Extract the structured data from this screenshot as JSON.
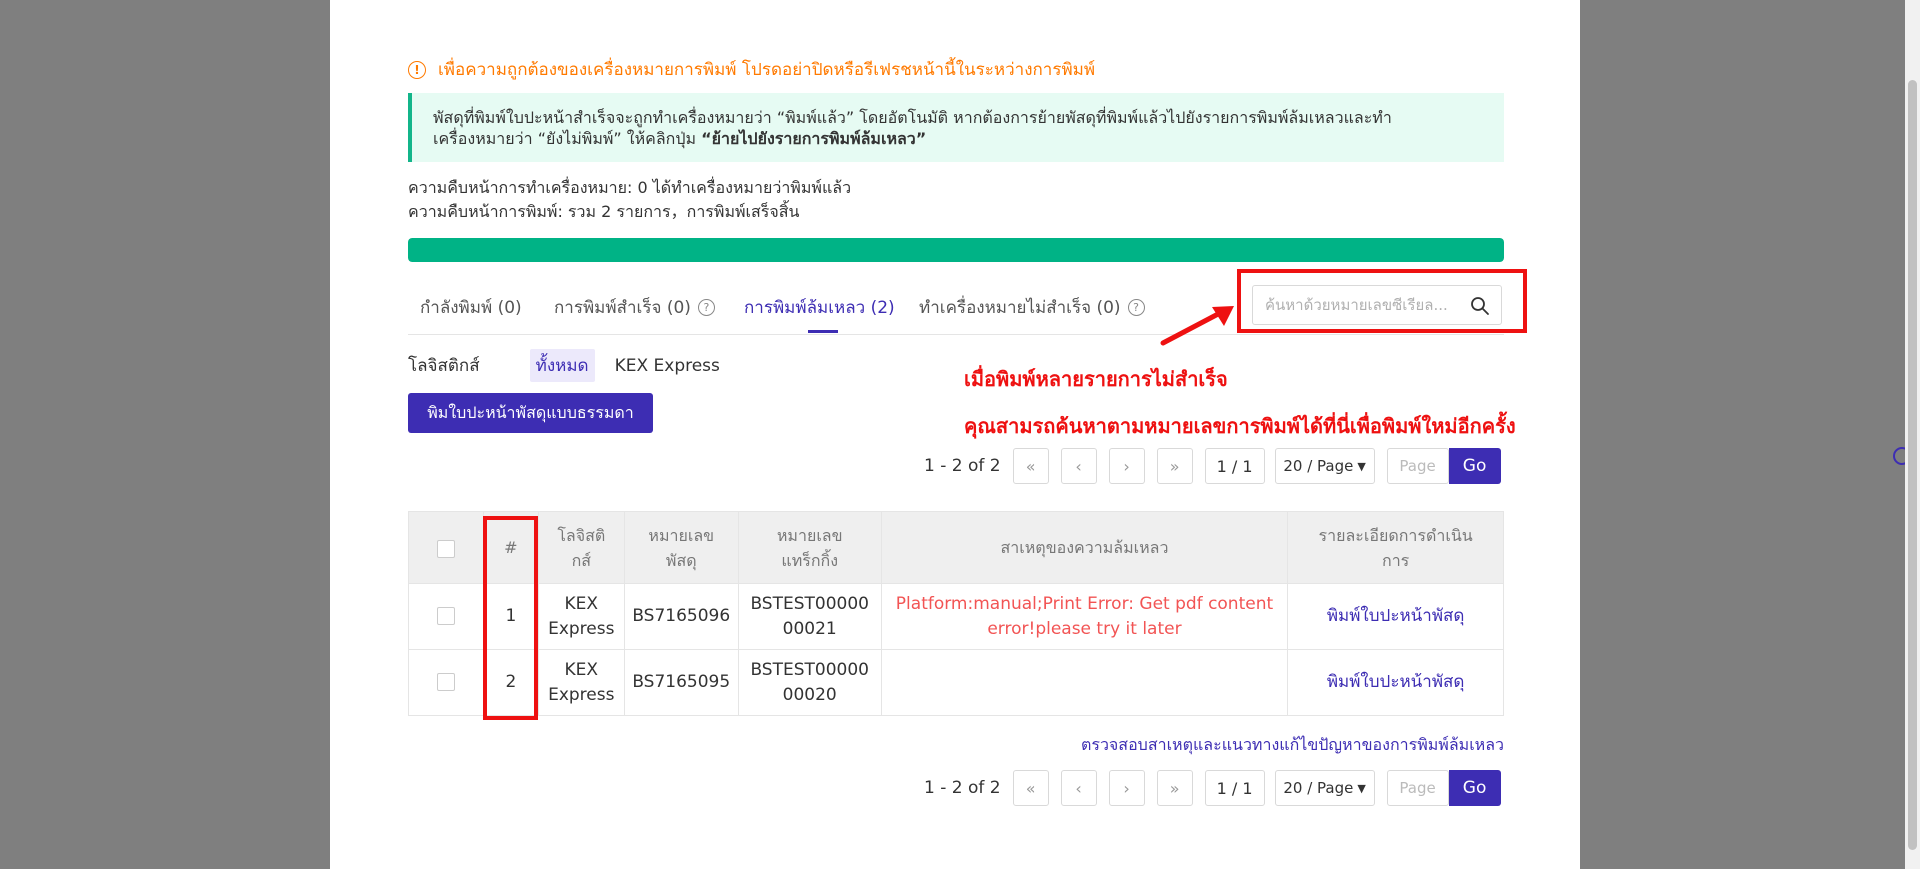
{
  "warning_text": "เพื่อความถูกต้องของเครื่องหมายการพิมพ์ โปรดอย่าปิดหรือรีเฟรชหน้านี้ในระหว่างการพิมพ์",
  "info": {
    "line1": "พัสดุที่พิมพ์ใบปะหน้าสำเร็จจะถูกทำเครื่องหมายว่า “พิมพ์แล้ว” โดยอัตโนมัติ หากต้องการย้ายพัสดุที่พิมพ์แล้วไปยังรายการพิมพ์ล้มเหลวและทำ",
    "line2_prefix": "เครื่องหมายว่า “ยังไม่พิมพ์” ให้คลิกปุ่ม ",
    "line2_bold": "“ย้ายไปยังรายการพิมพ์ล้มเหลว”"
  },
  "progress": {
    "marking_text": "ความคืบหน้าการทำเครื่องหมาย: 0 ได้ทำเครื่องหมายว่าพิมพ์แล้ว",
    "printing_text": "ความคืบหน้าการพิมพ์: รวม 2 รายการ，การพิมพ์เสร็จสิ้น",
    "fraction": 1.0,
    "color": "#00b386"
  },
  "tabs": [
    {
      "label": "กำลังพิมพ์ (0)"
    },
    {
      "label": "การพิมพ์สำเร็จ (0)"
    },
    {
      "label": "การพิมพ์ล้มเหลว (2)"
    },
    {
      "label": "ทำเครื่องหมายไม่สำเร็จ (0)"
    }
  ],
  "search": {
    "placeholder": "ค้นหาด้วยหมายเลขซีเรียล..."
  },
  "filter": {
    "label": "โลจิสติกส์",
    "all": "ทั้งหมด",
    "kex": "KEX Express"
  },
  "annotations": {
    "line1": "เมื่อพิมพ์หลายรายการไม่สำเร็จ",
    "line2": "คุณสามรถค้นหาตามหมายเลขการพิมพ์ได้ที่นี่เพื่อพิมพ์ใหม่อีกครั้ง"
  },
  "print_button": "พิมใบปะหน้าพัสดุแบบธรรมดา",
  "pager": {
    "count": "1 - 2 of 2",
    "current": "1 / 1",
    "size": "20 / Page",
    "page_placeholder": "Page",
    "go": "Go"
  },
  "table": {
    "headers": {
      "num": "#",
      "logistics": "โลจิสติ\nกส์",
      "parcel": "หมายเลข\nพัสดุ",
      "tracking": "หมายเลข\nแทร็กกิ้ง",
      "reason": "สาเหตุของความล้มเหลว",
      "action": "รายละเอียดการดำเนิน\nการ"
    },
    "rows": [
      {
        "num": "1",
        "logistics": "KEX\nExpress",
        "parcel": "BS7165096",
        "tracking": "BSTEST00000\n00021",
        "reason": "Platform:manual;Print Error: Get pdf content\nerror!please try it later",
        "action": "พิมพ์ใบปะหน้าพัสดุ"
      },
      {
        "num": "2",
        "logistics": "KEX\nExpress",
        "parcel": "BS7165095",
        "tracking": "BSTEST00000\n00020",
        "reason": "",
        "action": "พิมพ์ใบปะหน้าพัสดุ"
      }
    ]
  },
  "bottom_link": "ตรวจสอบสาเหตุและแนวทางแก้ไขปัญหาของการพิมพ์ล้มเหลว"
}
